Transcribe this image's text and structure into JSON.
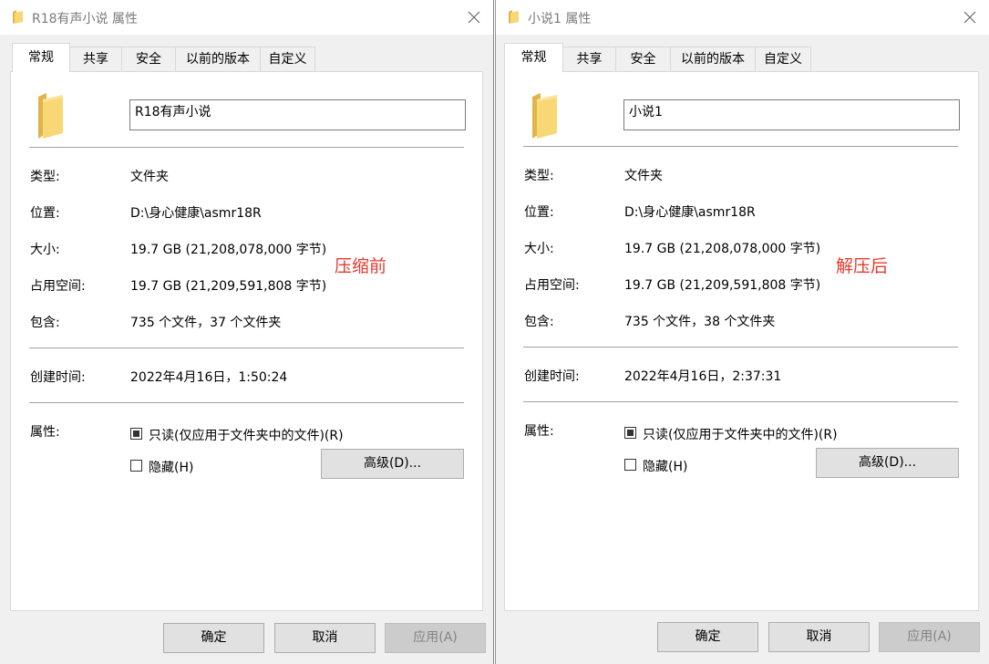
{
  "colors": {
    "annotation": "#e53b2e",
    "folder": "#f8d775",
    "folder_dark": "#e0b44a",
    "window_bg": "#f0f0f0"
  },
  "icons": {
    "title": "folder-icon",
    "close": "close-icon",
    "big": "folder-icon"
  },
  "left": {
    "title": "R18有声小说 属性",
    "tabs": [
      "常规",
      "共享",
      "安全",
      "以前的版本",
      "自定义"
    ],
    "name": "R18有声小说",
    "type_label": "类型:",
    "type_value": "文件夹",
    "location_label": "位置:",
    "location_value": "D:\\身心健康\\asmr18R",
    "size_label": "大小:",
    "size_value": "19.7 GB (21,208,078,000 字节)",
    "disk_label": "占用空间:",
    "disk_value": "19.7 GB (21,209,591,808 字节)",
    "contains_label": "包含:",
    "contains_value": "735 个文件，37 个文件夹",
    "created_label": "创建时间:",
    "created_value": "2022年4月16日，1:50:24",
    "attr_label": "属性:",
    "readonly_label": "只读(仅应用于文件夹中的文件)(R)",
    "hidden_label": "隐藏(H)",
    "advanced_button": "高级(D)...",
    "ok_button": "确定",
    "cancel_button": "取消",
    "apply_button": "应用(A)",
    "annotation": "压缩前"
  },
  "right": {
    "title": "小说1 属性",
    "tabs": [
      "常规",
      "共享",
      "安全",
      "以前的版本",
      "自定义"
    ],
    "name": "小说1",
    "type_label": "类型:",
    "type_value": "文件夹",
    "location_label": "位置:",
    "location_value": "D:\\身心健康\\asmr18R",
    "size_label": "大小:",
    "size_value": "19.7 GB (21,208,078,000 字节)",
    "disk_label": "占用空间:",
    "disk_value": "19.7 GB (21,209,591,808 字节)",
    "contains_label": "包含:",
    "contains_value": "735 个文件，38 个文件夹",
    "created_label": "创建时间:",
    "created_value": "2022年4月16日，2:37:31",
    "attr_label": "属性:",
    "readonly_label": "只读(仅应用于文件夹中的文件)(R)",
    "hidden_label": "隐藏(H)",
    "advanced_button": "高级(D)...",
    "ok_button": "确定",
    "cancel_button": "取消",
    "apply_button": "应用(A)",
    "annotation": "解压后"
  }
}
